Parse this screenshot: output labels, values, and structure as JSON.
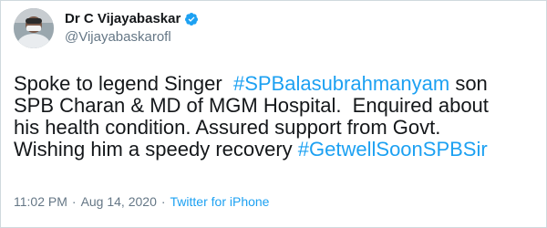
{
  "tweet": {
    "display_name": "Dr C Vijayabaskar",
    "handle": "@Vijayabaskarofl",
    "verified": true,
    "lines": [
      [
        {
          "t": "Spoke to legend Singer  ",
          "h": false
        },
        {
          "t": "#SPBalasubrahmanyam",
          "h": true
        },
        {
          "t": " son",
          "h": false
        }
      ],
      [
        {
          "t": "SPB Charan & MD of MGM Hospital.  Enquired about",
          "h": false
        }
      ],
      [
        {
          "t": "his health condition. Assured support from Govt.",
          "h": false
        }
      ],
      [
        {
          "t": "Wishing him a speedy recovery ",
          "h": false
        },
        {
          "t": "#GetwellSoonSPBSir",
          "h": true
        }
      ]
    ],
    "time": "11:02 PM",
    "date": "Aug 14, 2020",
    "source": "Twitter for iPhone",
    "separator": "·"
  },
  "colors": {
    "link": "#1da1f2",
    "text": "#14171a",
    "muted": "#657786",
    "verified": "#1da1f2"
  },
  "icons": {
    "verified": "verified-badge-icon",
    "avatar": "profile-avatar"
  }
}
